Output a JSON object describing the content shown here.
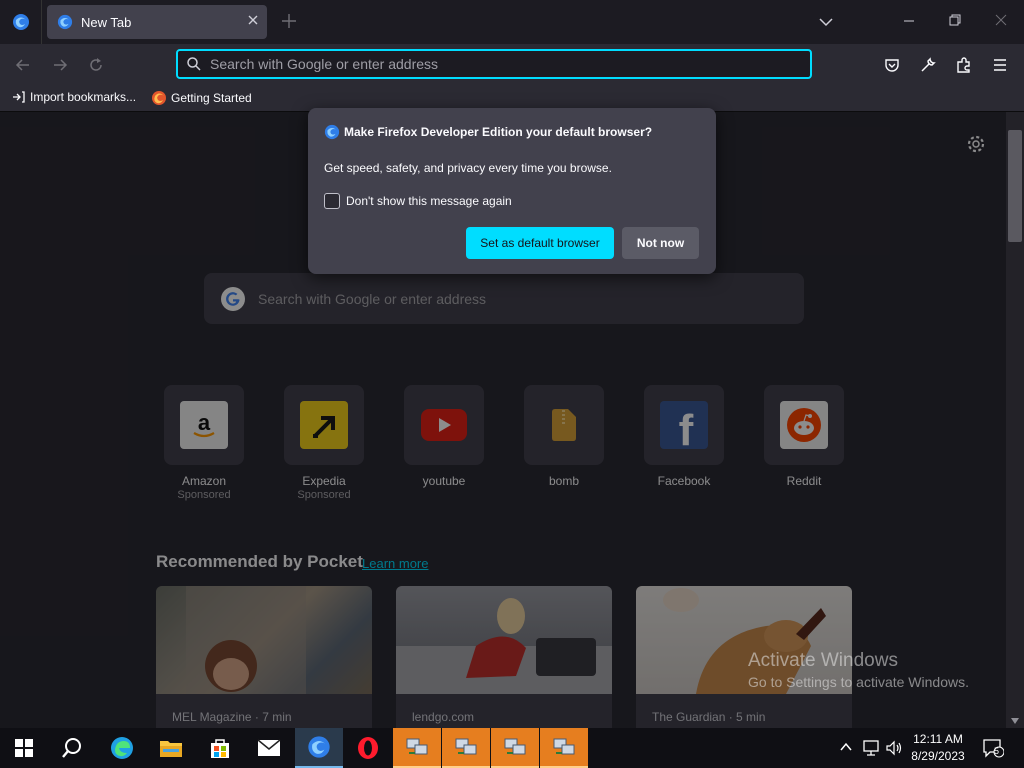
{
  "browser": {
    "tab_title": "New Tab",
    "url_placeholder": "Search with Google or enter address"
  },
  "bookmarks": [
    {
      "label": "Import bookmarks..."
    },
    {
      "label": "Getting Started"
    }
  ],
  "popup": {
    "title": "Make Firefox Developer Edition your default browser?",
    "body": "Get speed, safety, and privacy every time you browse.",
    "checkbox_label": "Don't show this message again",
    "primary_button": "Set as default browser",
    "secondary_button": "Not now"
  },
  "newtab": {
    "search_placeholder": "Search with Google or enter address",
    "top_sites": [
      {
        "label": "Amazon",
        "sponsored": "Sponsored",
        "icon": "amazon-icon"
      },
      {
        "label": "Expedia",
        "sponsored": "Sponsored",
        "icon": "expedia-icon"
      },
      {
        "label": "youtube",
        "sponsored": "",
        "icon": "youtube-icon"
      },
      {
        "label": "bomb",
        "sponsored": "",
        "icon": "zip-file-icon"
      },
      {
        "label": "Facebook",
        "sponsored": "",
        "icon": "facebook-icon"
      },
      {
        "label": "Reddit",
        "sponsored": "",
        "icon": "reddit-icon"
      }
    ],
    "pocket": {
      "heading": "Recommended by Pocket",
      "learn_more": "Learn more",
      "cards": [
        {
          "source": "MEL Magazine · 7 min"
        },
        {
          "source": "lendgo.com"
        },
        {
          "source": "The Guardian · 5 min"
        }
      ]
    }
  },
  "watermark": {
    "line1": "Activate Windows",
    "line2": "Go to Settings to activate Windows."
  },
  "taskbar": {
    "time": "12:11 AM",
    "date": "8/29/2023",
    "notifications": "5"
  },
  "colors": {
    "accent": "#00ddff",
    "taskbar_highlight": "#e67e1f"
  }
}
